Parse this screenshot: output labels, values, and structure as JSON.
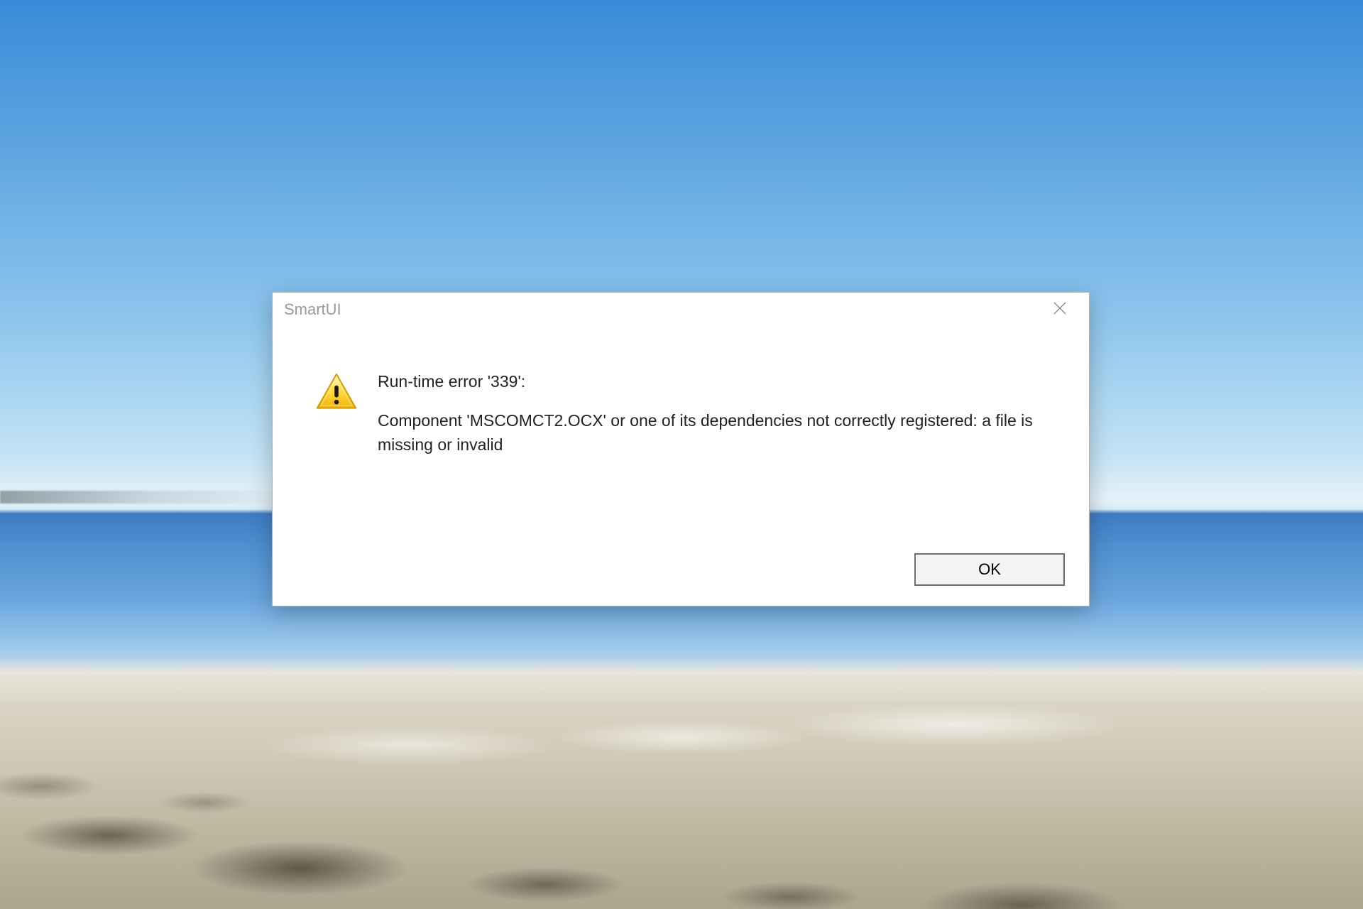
{
  "dialog": {
    "title": "SmartUI",
    "error_heading": "Run-time error '339':",
    "error_body": "Component 'MSCOMCT2.OCX' or one of its dependencies not correctly registered: a file is missing or invalid",
    "ok_label": "OK",
    "icon": "warning-icon"
  }
}
